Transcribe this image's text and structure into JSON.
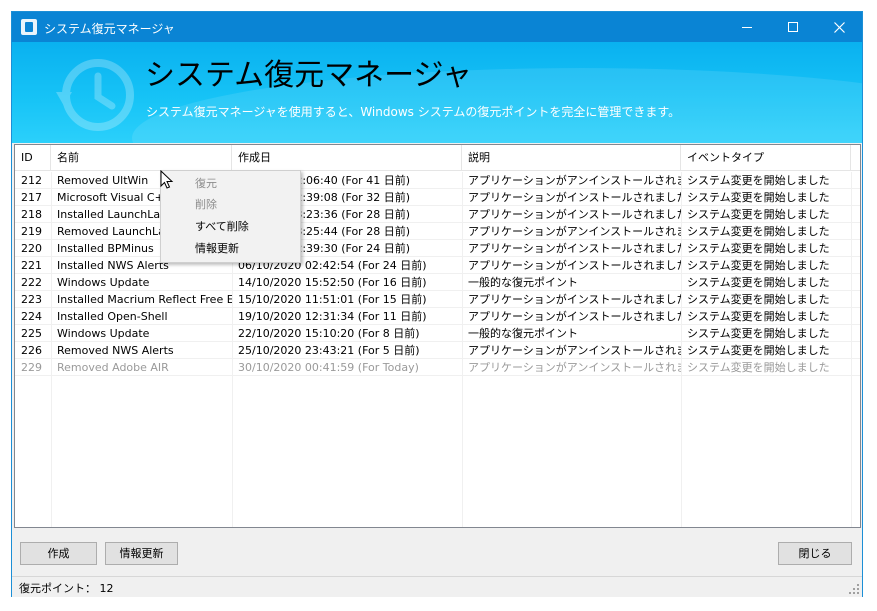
{
  "window": {
    "title": "システム復元マネージャ",
    "icons": {
      "app": "restore-app-icon",
      "minimize": "minimize-icon",
      "maximize": "maximize-icon",
      "close": "close-icon"
    }
  },
  "banner": {
    "title": "システム復元マネージャ",
    "subtitle": "システム復元マネージャを使用すると、Windows システムの復元ポイントを完全に管理できます。",
    "icon": "history-clock-icon"
  },
  "table": {
    "columns": [
      "ID",
      "名前",
      "作成日",
      "説明",
      "イベントタイプ"
    ],
    "rows": [
      [
        "212",
        "Removed UltWin",
        "2:06:40 (For 41 日前)",
        "アプリケーションがアンインストールされました",
        "システム変更を開始しました"
      ],
      [
        "217",
        "Microsoft Visual C++",
        "2:39:08 (For 32 日前)",
        "アプリケーションがインストールされました",
        "システム変更を開始しました"
      ],
      [
        "218",
        "Installed LaunchLater",
        "3:23:36 (For 28 日前)",
        "アプリケーションがインストールされました",
        "システム変更を開始しました"
      ],
      [
        "219",
        "Removed LaunchLater",
        "3:25:44 (For 28 日前)",
        "アプリケーションがアンインストールされました",
        "システム変更を開始しました"
      ],
      [
        "220",
        "Installed BPMinus",
        "2:39:30 (For 24 日前)",
        "アプリケーションがインストールされました",
        "システム変更を開始しました"
      ],
      [
        "221",
        "Installed NWS Alerts",
        "06/10/2020 02:42:54 (For 24 日前)",
        "アプリケーションがインストールされました",
        "システム変更を開始しました"
      ],
      [
        "222",
        "Windows Update",
        "14/10/2020 15:52:50 (For 16 日前)",
        "一般的な復元ポイント",
        "システム変更を開始しました"
      ],
      [
        "223",
        "Installed Macrium Reflect Free E...",
        "15/10/2020 11:51:01 (For 15 日前)",
        "アプリケーションがインストールされました",
        "システム変更を開始しました"
      ],
      [
        "224",
        "Installed Open-Shell",
        "19/10/2020 12:31:34 (For 11 日前)",
        "アプリケーションがインストールされました",
        "システム変更を開始しました"
      ],
      [
        "225",
        "Windows Update",
        "22/10/2020 15:10:20 (For 8 日前)",
        "一般的な復元ポイント",
        "システム変更を開始しました"
      ],
      [
        "226",
        "Removed NWS Alerts",
        "25/10/2020 23:43:21 (For 5 日前)",
        "アプリケーションがアンインストールされました",
        "システム変更を開始しました"
      ],
      [
        "229",
        "Removed Adobe AIR",
        "30/10/2020 00:41:59 (For Today)",
        "アプリケーションがアンインストールされました",
        "システム変更を開始しました"
      ]
    ]
  },
  "context_menu": {
    "items": [
      {
        "label": "復元",
        "disabled": true
      },
      {
        "label": "削除",
        "disabled": true
      },
      {
        "label": "すべて削除",
        "disabled": false
      },
      {
        "label": "情報更新",
        "disabled": false
      }
    ]
  },
  "buttons": {
    "create": "作成",
    "refresh": "情報更新",
    "close": "閉じる"
  },
  "status": {
    "restore_points": "復元ポイント： 12"
  },
  "colors": {
    "titlebar": "#0a84d4",
    "banner": "#16c3f6"
  }
}
